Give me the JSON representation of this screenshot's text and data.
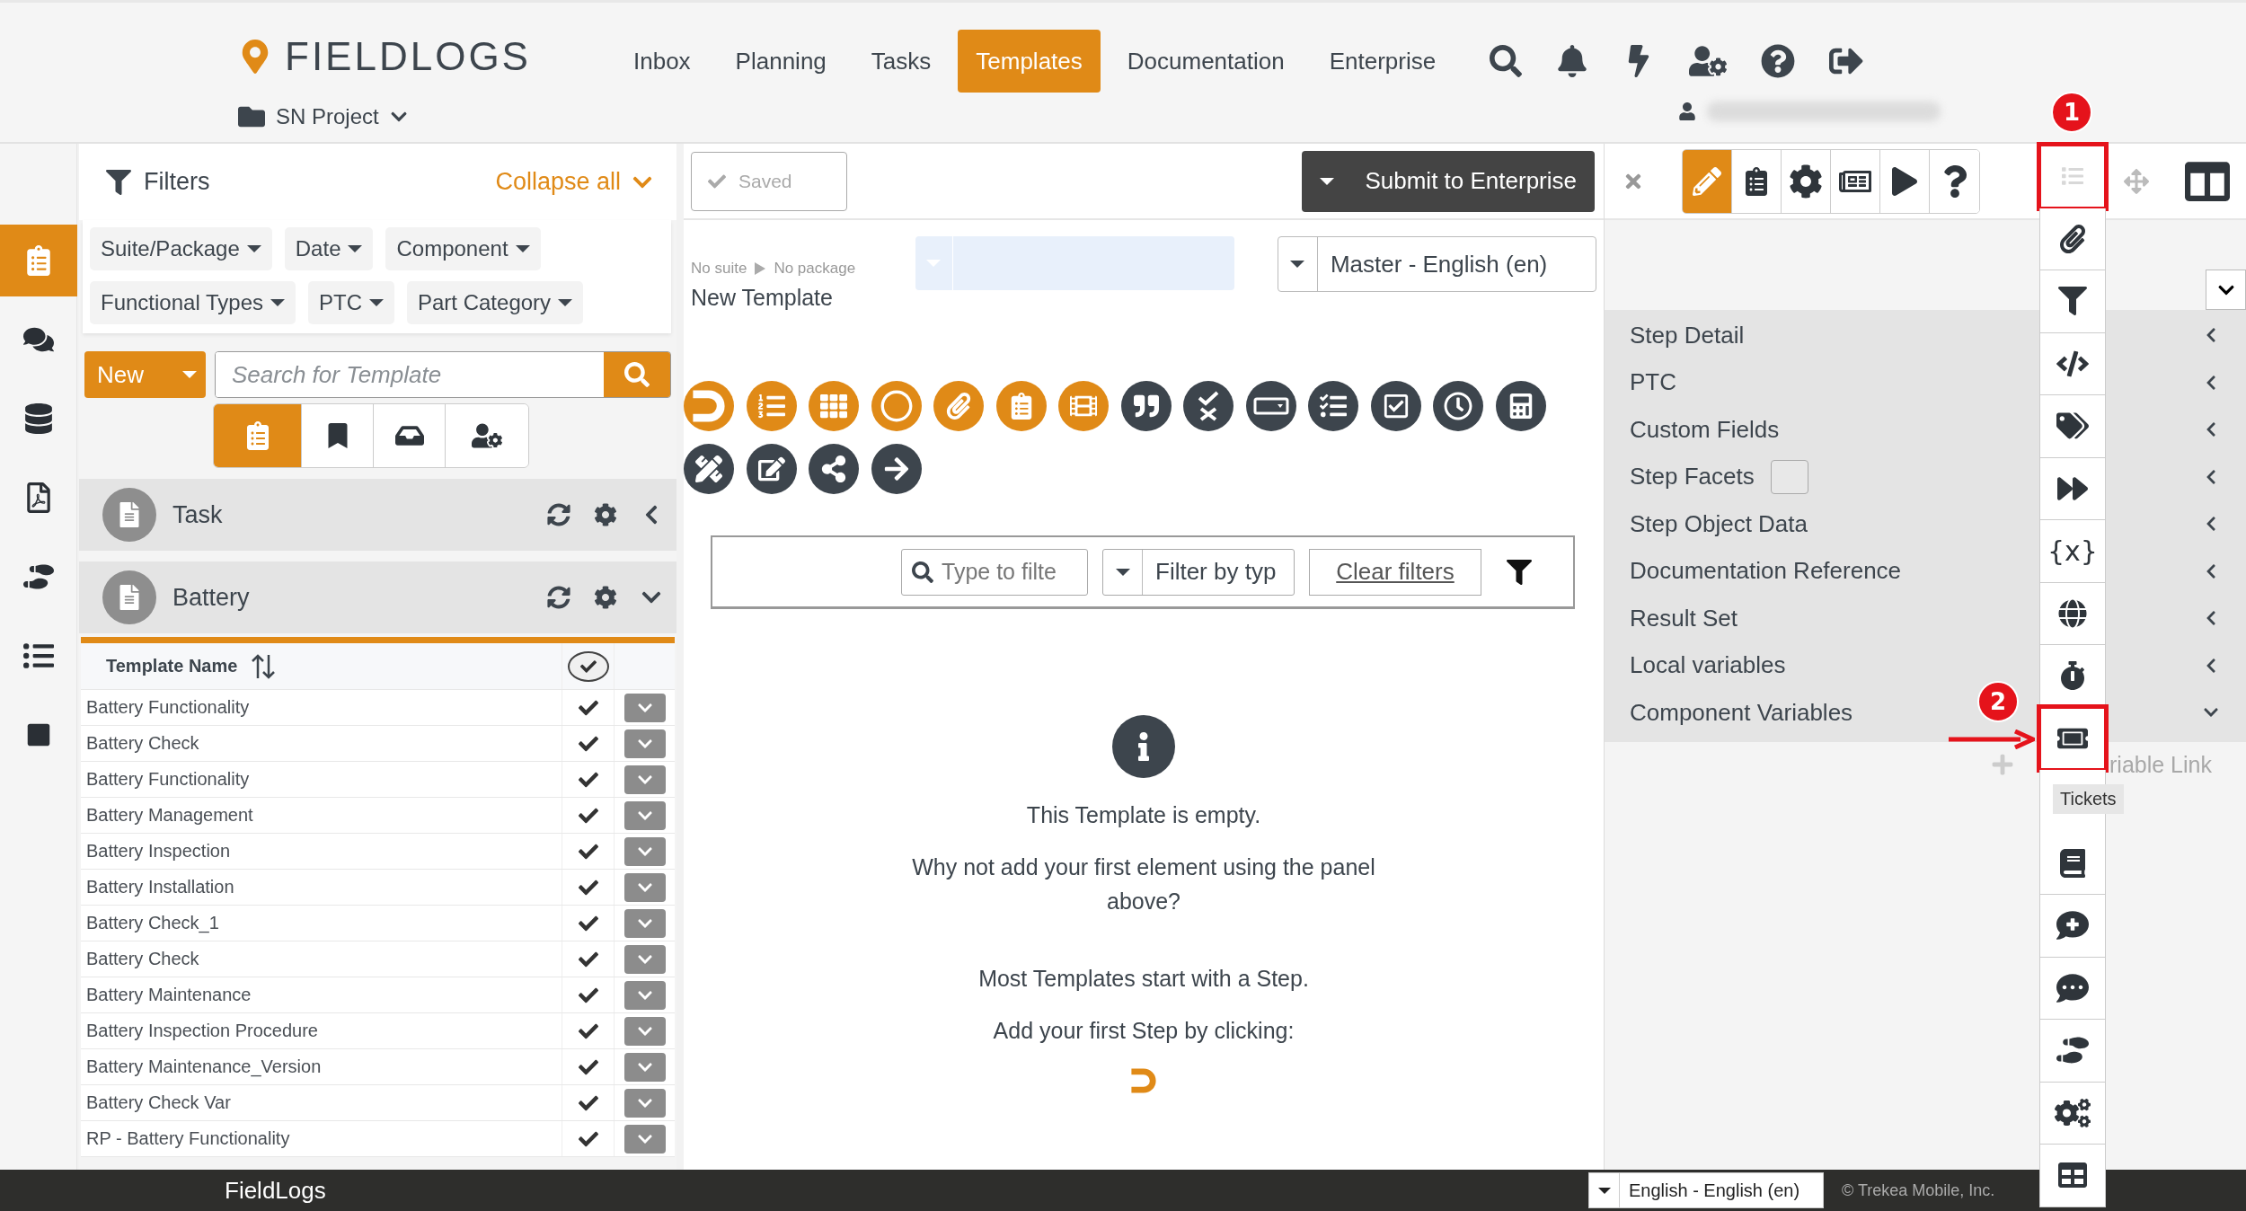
{
  "header": {
    "logo": "FIELDLOGS",
    "project": "SN Project",
    "nav": [
      {
        "label": "Inbox",
        "selected": false
      },
      {
        "label": "Planning",
        "selected": false
      },
      {
        "label": "Tasks",
        "selected": false
      },
      {
        "label": "Templates",
        "selected": true
      },
      {
        "label": "Documentation",
        "selected": false
      },
      {
        "label": "Enterprise",
        "selected": false
      }
    ]
  },
  "rail": [
    {
      "kind": "templates",
      "selected": true
    },
    {
      "kind": "comments",
      "selected": false
    },
    {
      "kind": "database",
      "selected": false
    },
    {
      "kind": "pdf",
      "selected": false
    },
    {
      "kind": "steps",
      "selected": false
    },
    {
      "kind": "list",
      "selected": false
    },
    {
      "kind": "stop",
      "selected": false
    }
  ],
  "filters": {
    "title": "Filters",
    "collapse": "Collapse all",
    "chips": [
      "Suite/Package",
      "Date",
      "Component",
      "Functional Types",
      "PTC",
      "Part Category"
    ]
  },
  "new_button": "New",
  "search": {
    "placeholder": "Search for Template"
  },
  "views": [
    {
      "kind": "templates",
      "selected": true
    },
    {
      "kind": "bookmarks",
      "selected": false
    },
    {
      "kind": "inbox",
      "selected": false
    },
    {
      "kind": "user-settings",
      "selected": false
    }
  ],
  "groups": [
    {
      "name": "Task",
      "expanded": false
    },
    {
      "name": "Battery",
      "expanded": true
    }
  ],
  "table": {
    "columns": [
      "Template Name"
    ],
    "rows": [
      {
        "name": "Battery Functionality",
        "checked": true
      },
      {
        "name": "Battery Check",
        "checked": true
      },
      {
        "name": "Battery Functionality",
        "checked": true
      },
      {
        "name": "Battery Management",
        "checked": true
      },
      {
        "name": "Battery Inspection",
        "checked": true
      },
      {
        "name": "Battery Installation",
        "checked": true
      },
      {
        "name": "Battery Check_1",
        "checked": true
      },
      {
        "name": "Battery Check",
        "checked": true
      },
      {
        "name": "Battery Maintenance",
        "checked": true
      },
      {
        "name": "Battery Inspection Procedure",
        "checked": true
      },
      {
        "name": "Battery Maintenance_Version",
        "checked": true
      },
      {
        "name": "Battery Check Var",
        "checked": true
      },
      {
        "name": "RP - Battery Functionality",
        "checked": true
      }
    ]
  },
  "editor": {
    "saved": "Saved",
    "submit": "Submit to Enterprise",
    "breadcrumb": [
      "No suite",
      "No package"
    ],
    "title": "New Template",
    "language": "Master - English (en)",
    "palette": [
      {
        "kind": "step",
        "color": "#e08a17"
      },
      {
        "kind": "numbered-list",
        "color": "#e08a17"
      },
      {
        "kind": "table",
        "color": "#e08a17"
      },
      {
        "kind": "circle",
        "color": "#e08a17"
      },
      {
        "kind": "attachment",
        "color": "#e08a17"
      },
      {
        "kind": "checklist",
        "color": "#e08a17"
      },
      {
        "kind": "film",
        "color": "#e08a17"
      },
      {
        "kind": "quote",
        "color": "#3d454d"
      },
      {
        "kind": "pass-fail",
        "color": "#3d454d"
      },
      {
        "kind": "dropdown",
        "color": "#3d454d"
      },
      {
        "kind": "tasks",
        "color": "#3d454d"
      },
      {
        "kind": "checkbox",
        "color": "#3d454d"
      },
      {
        "kind": "clock",
        "color": "#3d454d"
      },
      {
        "kind": "calculator",
        "color": "#3d454d"
      },
      {
        "kind": "ruler",
        "color": "#3d454d"
      },
      {
        "kind": "edit",
        "color": "#3d454d"
      },
      {
        "kind": "share",
        "color": "#3d454d"
      },
      {
        "kind": "next",
        "color": "#3d454d"
      }
    ],
    "filter_bar": {
      "search_placeholder": "Type to filte",
      "type_placeholder": "Filter by typ",
      "clear": "Clear filters"
    },
    "empty": {
      "title": "This Template is empty.",
      "hint": "Why not add your first element using the panel above?",
      "note": "Most Templates start with a Step.",
      "cta": "Add your first Step by clicking:"
    }
  },
  "inspector": {
    "tools": [
      {
        "kind": "edit",
        "selected": true
      },
      {
        "kind": "checklist",
        "selected": false
      },
      {
        "kind": "settings",
        "selected": false
      },
      {
        "kind": "preview",
        "selected": false
      },
      {
        "kind": "run",
        "selected": false
      },
      {
        "kind": "help",
        "selected": false
      }
    ],
    "sections": [
      {
        "label": "Step Detail",
        "expanded": false
      },
      {
        "label": "PTC",
        "expanded": false
      },
      {
        "label": "Custom Fields",
        "expanded": false
      },
      {
        "label": "Step Facets",
        "expanded": false,
        "checked": false
      },
      {
        "label": "Step Object Data",
        "expanded": false
      },
      {
        "label": "Documentation Reference",
        "expanded": false
      },
      {
        "label": "Result Set",
        "expanded": false
      },
      {
        "label": "Local variables",
        "expanded": false
      },
      {
        "label": "Component Variables",
        "expanded": true
      }
    ],
    "link_fragment": "riable Link",
    "side_tools": [
      {
        "kind": "list",
        "disabled": true,
        "callout": "1"
      },
      {
        "kind": "attach",
        "disabled": false
      },
      {
        "kind": "filter",
        "disabled": false
      },
      {
        "kind": "code",
        "disabled": false
      },
      {
        "kind": "tags",
        "disabled": false
      },
      {
        "kind": "forward",
        "disabled": false
      },
      {
        "kind": "variables",
        "label": "{x}",
        "disabled": false
      },
      {
        "kind": "globe",
        "disabled": false
      },
      {
        "kind": "timer",
        "disabled": false
      },
      {
        "kind": "ticket",
        "disabled": false,
        "callout": "2",
        "tooltip": "Tickets"
      },
      {
        "kind": "book",
        "disabled": false
      },
      {
        "kind": "comment-add",
        "disabled": false
      },
      {
        "kind": "comment-edit",
        "disabled": false
      },
      {
        "kind": "steps",
        "disabled": false
      },
      {
        "kind": "cogs",
        "disabled": false
      },
      {
        "kind": "table",
        "disabled": false
      }
    ]
  },
  "footer": {
    "brand": "FieldLogs",
    "language": "English - English (en)",
    "copyright": "© Trekea Mobile, Inc."
  }
}
